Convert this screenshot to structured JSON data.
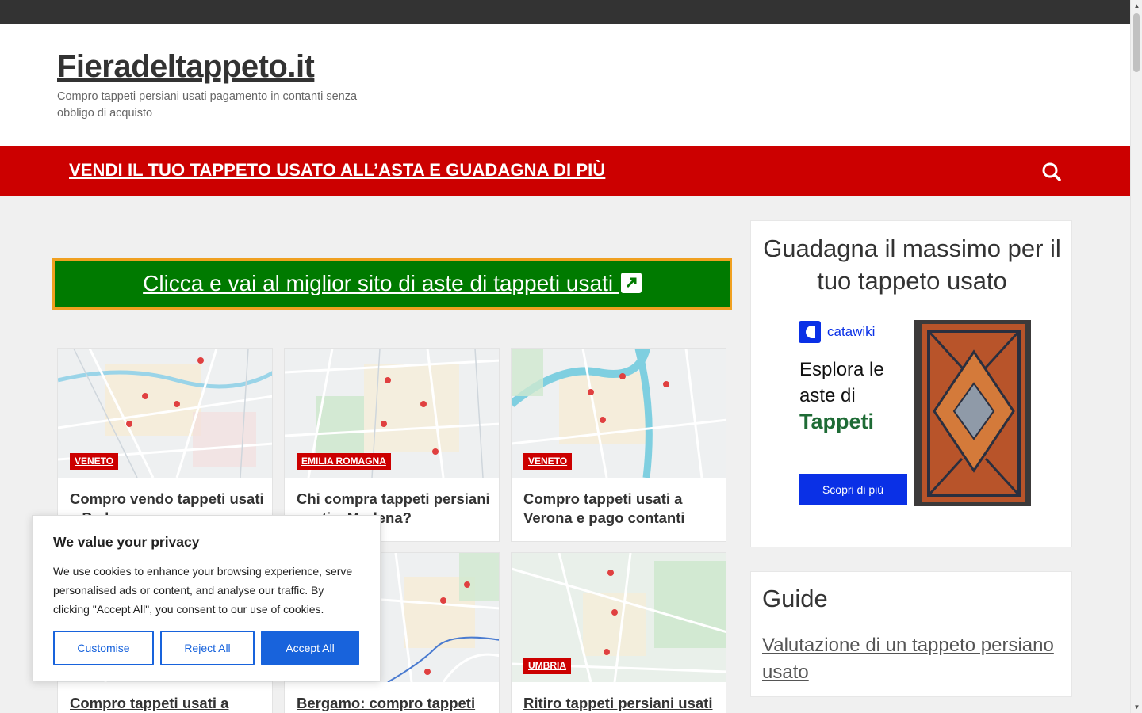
{
  "site": {
    "title": "Fieradeltappeto.it",
    "tagline": "Compro tappeti persiani usati pagamento in contanti senza obbligo di acquisto"
  },
  "nav": {
    "link": "VENDI IL TUO TAPPETO USATO ALL’ASTA E GUADAGNA DI PIÙ",
    "search_icon": "search-icon"
  },
  "cta": {
    "label": "Clicca e vai al miglior sito di aste di tappeti usati ",
    "icon": "external-link-icon",
    "bg_color": "#007a00",
    "border_color": "#f0a020"
  },
  "cards": [
    {
      "badge": "VENETO",
      "title": "Compro vendo tappeti usati a Padova"
    },
    {
      "badge": "EMILIA ROMAGNA",
      "title": "Chi compra tappeti persiani usati a Modena?"
    },
    {
      "badge": "VENETO",
      "title": "Compro tappeti usati a Verona e pago contanti"
    },
    {
      "badge": "",
      "title": "Compro tappeti usati a"
    },
    {
      "badge": "",
      "title": "Bergamo: compro tappeti"
    },
    {
      "badge": "UMBRIA",
      "title": "Ritiro tappeti persiani usati"
    }
  ],
  "sidebar_ad": {
    "heading": "Guadagna il massimo per il tuo tappeto usato",
    "brand": "catawiki",
    "line1": "Esplora le",
    "line2": "aste di",
    "line3": "Tappeti",
    "button": "Scopri di più"
  },
  "sidebar_guide": {
    "heading": "Guide",
    "link": "Valutazione di un tappeto persiano usato"
  },
  "cookie": {
    "title": "We value your privacy",
    "text": "We use cookies to enhance your browsing experience, serve personalised ads or content, and analyse our traffic. By clicking \"Accept All\", you consent to our use of cookies.",
    "customise": "Customise",
    "reject": "Reject All",
    "accept": "Accept All"
  },
  "colors": {
    "nav_red": "#cc0000",
    "cookie_blue": "#1863dc",
    "catawiki_blue": "#0a30e6"
  }
}
